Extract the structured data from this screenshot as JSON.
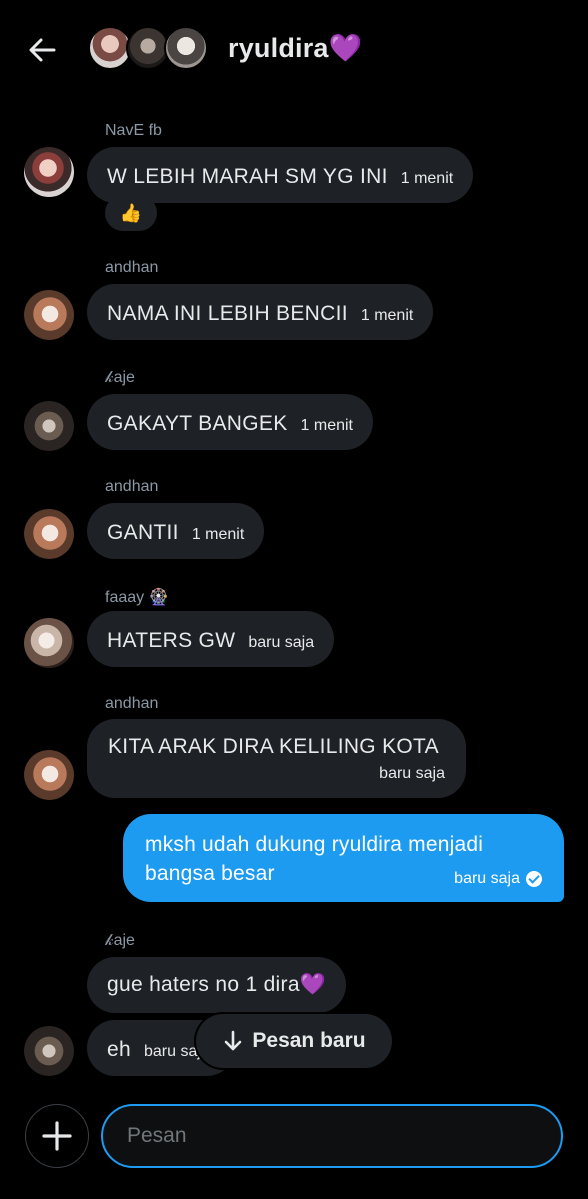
{
  "header": {
    "title": "ryuldira💜",
    "back_icon": "arrow-left-icon"
  },
  "messages": [
    {
      "sender": "NavE fb",
      "text": "W LEBIH MARAH SM YG INI",
      "time": "1 menit",
      "reaction": "👍"
    },
    {
      "sender": "andhan",
      "text": "NAMA INI LEBIH BENCII",
      "time": "1 menit"
    },
    {
      "sender": "𝓀aje",
      "text": "GAKAYT BANGEK",
      "time": "1 menit"
    },
    {
      "sender": "andhan",
      "text": "GANTII",
      "time": "1 menit"
    },
    {
      "sender": "faaay 🎡",
      "text": "HATERS GW",
      "time": "baru saja"
    },
    {
      "sender": "andhan",
      "text": "KITA ARAK DIRA KELILING KOTA",
      "time": "baru saja"
    },
    {
      "sender": "me",
      "text": "mksh udah dukung ryuldira menjadi bangsa besar",
      "time": "baru saja",
      "status_icon": "check-circle-icon"
    },
    {
      "sender": "𝓀aje",
      "text": "gue haters no 1 dira💜"
    },
    {
      "text": "eh",
      "time": "baru saja"
    }
  ],
  "new_messages_button": {
    "label": "Pesan baru",
    "icon": "arrow-down-icon"
  },
  "composer": {
    "placeholder": "Pesan",
    "add_icon": "plus-icon"
  },
  "colors": {
    "accent": "#1d9bf0",
    "bubble": "#1e2125",
    "background": "#000000",
    "muted": "#8b98a5"
  }
}
